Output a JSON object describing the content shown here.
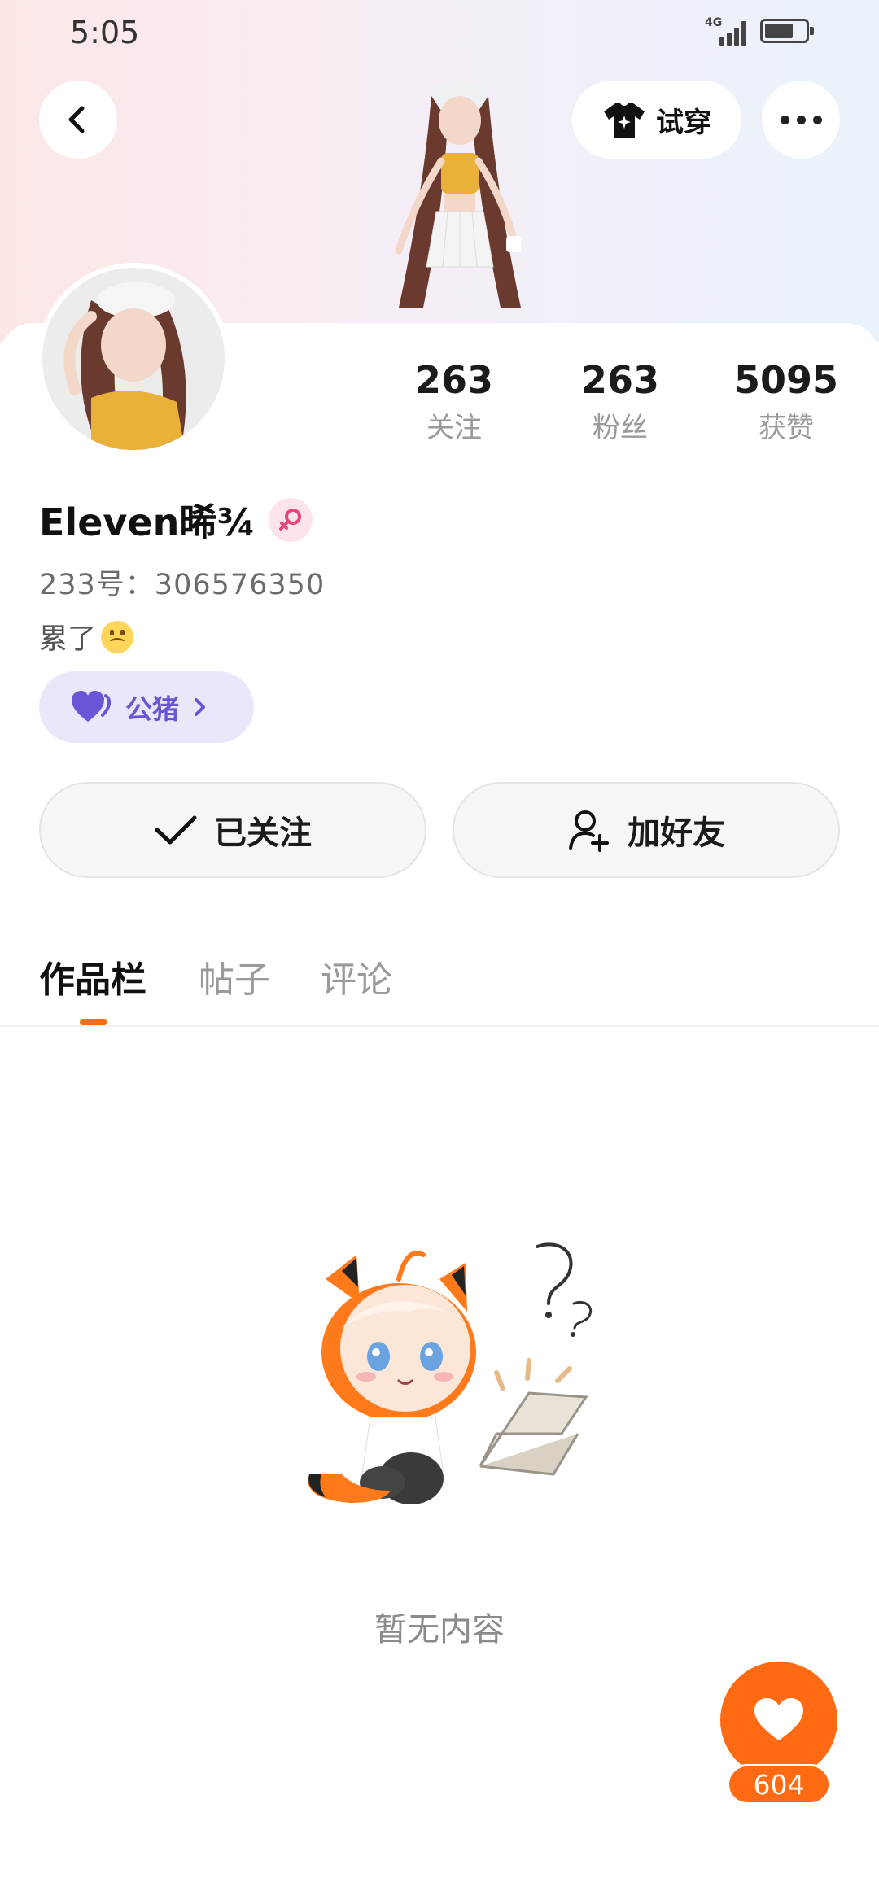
{
  "status_bar": {
    "time": "5:05",
    "network": "4G"
  },
  "header": {
    "tryon_label": "试穿",
    "back_icon": "chevron-left-icon",
    "more_icon": "more-dots-icon"
  },
  "profile": {
    "name": "Eleven晞¾",
    "gender": "female",
    "uid": "233号：306576350",
    "bio": "累了",
    "guild_label": "公猪"
  },
  "stats": [
    {
      "num": "263",
      "label": "关注"
    },
    {
      "num": "263",
      "label": "粉丝"
    },
    {
      "num": "5095",
      "label": "获赞"
    }
  ],
  "actions": {
    "followed_label": "已关注",
    "add_friend_label": "加好友"
  },
  "tabs": [
    {
      "label": "作品栏",
      "active": true
    },
    {
      "label": "帖子",
      "active": false
    },
    {
      "label": "评论",
      "active": false
    }
  ],
  "empty_state": {
    "text": "暂无内容"
  },
  "like": {
    "count": "604"
  },
  "colors": {
    "accent": "#ff6a13",
    "guild": "#6a55d6",
    "female_badge": "#fde3ea"
  }
}
